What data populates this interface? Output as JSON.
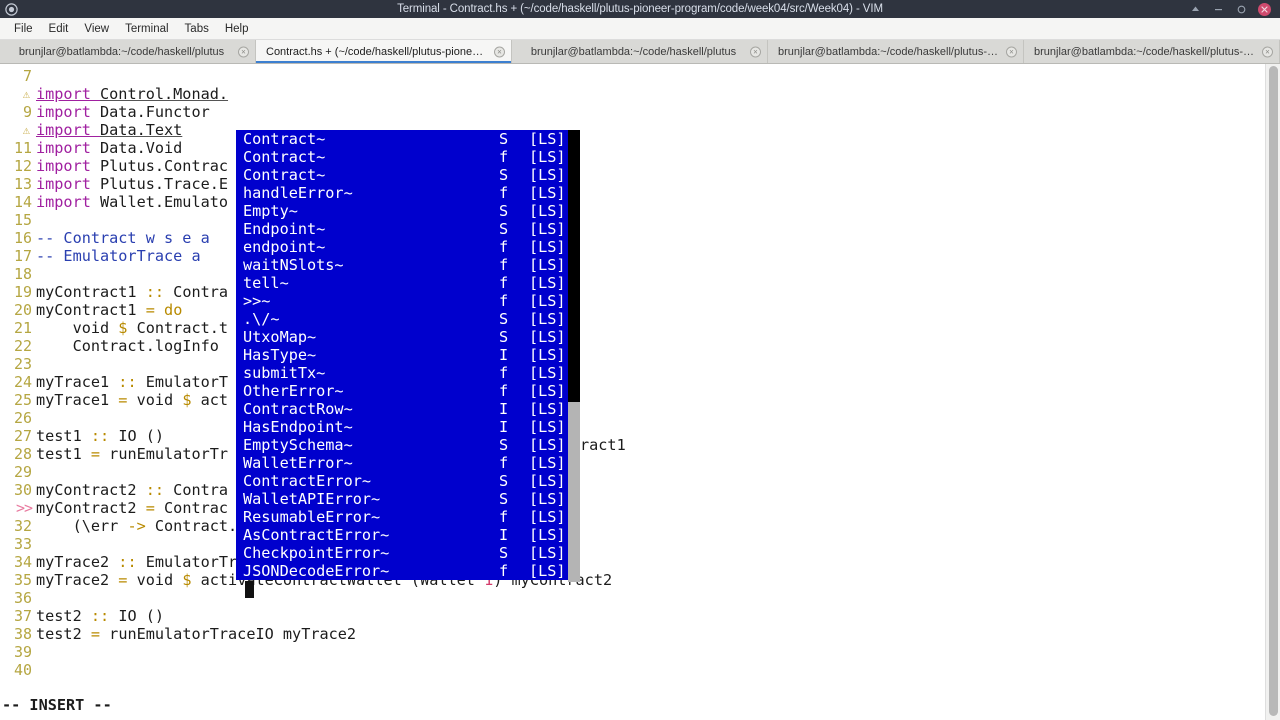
{
  "window": {
    "title": "Terminal - Contract.hs + (~/code/haskell/plutus-pioneer-program/code/week04/src/Week04) - VIM",
    "app_icon": "terminal-icon",
    "controls": [
      {
        "name": "shade-button",
        "glyph": "shade-icon"
      },
      {
        "name": "minimize-button",
        "glyph": "minimize-icon"
      },
      {
        "name": "maximize-button",
        "glyph": "maximize-icon"
      },
      {
        "name": "close-button",
        "glyph": "close-icon"
      }
    ]
  },
  "menubar": {
    "items": [
      {
        "label": "File"
      },
      {
        "label": "Edit"
      },
      {
        "label": "View"
      },
      {
        "label": "Terminal"
      },
      {
        "label": "Tabs"
      },
      {
        "label": "Help"
      }
    ]
  },
  "tabs": [
    {
      "label": "brunjlar@batlambda:~/code/haskell/plutus",
      "active": false,
      "close": "×"
    },
    {
      "label": "Contract.hs + (~/code/haskell/plutus-pioneer-...",
      "active": true,
      "close": "×"
    },
    {
      "label": "brunjlar@batlambda:~/code/haskell/plutus",
      "active": false,
      "close": "×"
    },
    {
      "label": "brunjlar@batlambda:~/code/haskell/plutus-p...",
      "active": false,
      "close": "×"
    },
    {
      "label": "brunjlar@batlambda:~/code/haskell/plutus-h...",
      "active": false,
      "close": "×"
    }
  ],
  "editor": {
    "status_line": "-- INSERT --",
    "lines": [
      {
        "num": "7",
        "gutter_kind": "number",
        "segments": []
      },
      {
        "num": "⚠",
        "gutter_kind": "warn",
        "segments": [
          {
            "t": "import ",
            "c": "kw-u"
          },
          {
            "t": "Control.Monad.",
            "c": "undl"
          }
        ]
      },
      {
        "num": "9",
        "gutter_kind": "number",
        "segments": [
          {
            "t": "import ",
            "c": "kw"
          },
          {
            "t": "Data.Functor",
            "c": "plain"
          }
        ]
      },
      {
        "num": "⚠",
        "gutter_kind": "warn",
        "segments": [
          {
            "t": "import ",
            "c": "kw-u"
          },
          {
            "t": "Data.Text",
            "c": "undl"
          }
        ]
      },
      {
        "num": "11",
        "gutter_kind": "number",
        "segments": [
          {
            "t": "import ",
            "c": "kw"
          },
          {
            "t": "Data.Void",
            "c": "plain"
          }
        ]
      },
      {
        "num": "12",
        "gutter_kind": "number",
        "segments": [
          {
            "t": "import ",
            "c": "kw"
          },
          {
            "t": "Plutus.Contrac",
            "c": "plain"
          }
        ]
      },
      {
        "num": "13",
        "gutter_kind": "number",
        "segments": [
          {
            "t": "import ",
            "c": "kw"
          },
          {
            "t": "Plutus.Trace.E",
            "c": "plain"
          }
        ]
      },
      {
        "num": "14",
        "gutter_kind": "number",
        "segments": [
          {
            "t": "import ",
            "c": "kw"
          },
          {
            "t": "Wallet.Emulato",
            "c": "plain"
          }
        ]
      },
      {
        "num": "15",
        "gutter_kind": "number",
        "segments": []
      },
      {
        "num": "16",
        "gutter_kind": "number",
        "segments": [
          {
            "t": "-- Contract w s e a",
            "c": "cmt"
          }
        ]
      },
      {
        "num": "17",
        "gutter_kind": "number",
        "segments": [
          {
            "t": "-- EmulatorTrace a",
            "c": "cmt"
          }
        ]
      },
      {
        "num": "18",
        "gutter_kind": "number",
        "segments": []
      },
      {
        "num": "19",
        "gutter_kind": "number",
        "segments": [
          {
            "t": "myContract1 ",
            "c": "plain"
          },
          {
            "t": "::",
            "c": "op"
          },
          {
            "t": " Contra",
            "c": "plain"
          }
        ]
      },
      {
        "num": "20",
        "gutter_kind": "number",
        "segments": [
          {
            "t": "myContract1 ",
            "c": "plain"
          },
          {
            "t": "=",
            "c": "op"
          },
          {
            "t": " ",
            "c": "plain"
          },
          {
            "t": "do",
            "c": "op"
          }
        ]
      },
      {
        "num": "21",
        "gutter_kind": "number",
        "segments": [
          {
            "t": "    void ",
            "c": "plain"
          },
          {
            "t": "$",
            "c": "op"
          },
          {
            "t": " Contract.t",
            "c": "plain"
          }
        ]
      },
      {
        "num": "22",
        "gutter_kind": "number",
        "segments": [
          {
            "t": "    Contract.logInfo",
            "c": "plain"
          }
        ]
      },
      {
        "num": "23",
        "gutter_kind": "number",
        "segments": []
      },
      {
        "num": "24",
        "gutter_kind": "number",
        "segments": [
          {
            "t": "myTrace1 ",
            "c": "plain"
          },
          {
            "t": "::",
            "c": "op"
          },
          {
            "t": " EmulatorT",
            "c": "plain"
          }
        ]
      },
      {
        "num": "25",
        "gutter_kind": "number",
        "segments": [
          {
            "t": "myTrace1 ",
            "c": "plain"
          },
          {
            "t": "=",
            "c": "op"
          },
          {
            "t": " void ",
            "c": "plain"
          },
          {
            "t": "$",
            "c": "op"
          },
          {
            "t": " act",
            "c": "plain"
          }
        ]
      },
      {
        "num": "26",
        "gutter_kind": "number",
        "segments": []
      },
      {
        "num": "27",
        "gutter_kind": "number",
        "segments": [
          {
            "t": "test1 ",
            "c": "plain"
          },
          {
            "t": "::",
            "c": "op"
          },
          {
            "t": " IO ()",
            "c": "plain"
          }
        ]
      },
      {
        "num": "28",
        "gutter_kind": "number",
        "segments": [
          {
            "t": "test1 ",
            "c": "plain"
          },
          {
            "t": "=",
            "c": "op"
          },
          {
            "t": " runEmulatorTr",
            "c": "plain"
          }
        ]
      },
      {
        "num": "29",
        "gutter_kind": "number",
        "segments": []
      },
      {
        "num": "30",
        "gutter_kind": "number",
        "segments": [
          {
            "t": "myContract2 ",
            "c": "plain"
          },
          {
            "t": "::",
            "c": "op"
          },
          {
            "t": " Contra",
            "c": "plain"
          }
        ]
      },
      {
        "num": ">>",
        "gutter_kind": "marker",
        "segments": [
          {
            "t": "myContract2 ",
            "c": "plain"
          },
          {
            "t": "=",
            "c": "op"
          },
          {
            "t": " Contrac",
            "c": "plain"
          }
        ]
      },
      {
        "num": "32",
        "gutter_kind": "number",
        "segments": [
          {
            "t": "    (\\err ",
            "c": "plain"
          },
          {
            "t": "->",
            "c": "op"
          },
          {
            "t": " Contract.",
            "c": "plain"
          }
        ]
      },
      {
        "num": "33",
        "gutter_kind": "number",
        "segments": []
      },
      {
        "num": "34",
        "gutter_kind": "number",
        "segments": [
          {
            "t": "myTrace2 ",
            "c": "plain"
          },
          {
            "t": "::",
            "c": "op"
          },
          {
            "t": " EmulatorTrace ()",
            "c": "plain"
          }
        ]
      },
      {
        "num": "35",
        "gutter_kind": "number",
        "segments": [
          {
            "t": "myTrace2 ",
            "c": "plain"
          },
          {
            "t": "=",
            "c": "op"
          },
          {
            "t": " void ",
            "c": "plain"
          },
          {
            "t": "$",
            "c": "op"
          },
          {
            "t": " activateContractWallet (Wallet ",
            "c": "plain"
          },
          {
            "t": "1",
            "c": "num"
          },
          {
            "t": ") myContract2",
            "c": "plain"
          }
        ]
      },
      {
        "num": "36",
        "gutter_kind": "number",
        "segments": []
      },
      {
        "num": "37",
        "gutter_kind": "number",
        "segments": [
          {
            "t": "test2 ",
            "c": "plain"
          },
          {
            "t": "::",
            "c": "op"
          },
          {
            "t": " IO ()",
            "c": "plain"
          }
        ]
      },
      {
        "num": "38",
        "gutter_kind": "number",
        "segments": [
          {
            "t": "test2 ",
            "c": "plain"
          },
          {
            "t": "=",
            "c": "op"
          },
          {
            "t": " runEmulatorTraceIO myTrace2",
            "c": "plain"
          }
        ]
      },
      {
        "num": "39",
        "gutter_kind": "number",
        "segments": []
      },
      {
        "num": "40",
        "gutter_kind": "number",
        "segments": []
      }
    ],
    "overflow_text": {
      "line25_tail": "ract1"
    }
  },
  "autocomplete": {
    "background": "#0000cd",
    "foreground": "#ffffff",
    "entries": [
      {
        "word": "Contract~",
        "kind": "S",
        "menu": "[LS]"
      },
      {
        "word": "Contract~",
        "kind": "f",
        "menu": "[LS]"
      },
      {
        "word": "Contract~",
        "kind": "S",
        "menu": "[LS]"
      },
      {
        "word": "handleError~",
        "kind": "f",
        "menu": "[LS]"
      },
      {
        "word": "Empty~",
        "kind": "S",
        "menu": "[LS]"
      },
      {
        "word": "Endpoint~",
        "kind": "S",
        "menu": "[LS]"
      },
      {
        "word": "endpoint~",
        "kind": "f",
        "menu": "[LS]"
      },
      {
        "word": "waitNSlots~",
        "kind": "f",
        "menu": "[LS]"
      },
      {
        "word": "tell~",
        "kind": "f",
        "menu": "[LS]"
      },
      {
        "word": ">>~",
        "kind": "f",
        "menu": "[LS]"
      },
      {
        "word": ".\\/~",
        "kind": "S",
        "menu": "[LS]"
      },
      {
        "word": "UtxoMap~",
        "kind": "S",
        "menu": "[LS]"
      },
      {
        "word": "HasType~",
        "kind": "I",
        "menu": "[LS]"
      },
      {
        "word": "submitTx~",
        "kind": "f",
        "menu": "[LS]"
      },
      {
        "word": "OtherError~",
        "kind": "f",
        "menu": "[LS]"
      },
      {
        "word": "ContractRow~",
        "kind": "I",
        "menu": "[LS]"
      },
      {
        "word": "HasEndpoint~",
        "kind": "I",
        "menu": "[LS]"
      },
      {
        "word": "EmptySchema~",
        "kind": "S",
        "menu": "[LS]"
      },
      {
        "word": "WalletError~",
        "kind": "f",
        "menu": "[LS]"
      },
      {
        "word": "ContractError~",
        "kind": "S",
        "menu": "[LS]"
      },
      {
        "word": "WalletAPIError~",
        "kind": "S",
        "menu": "[LS]"
      },
      {
        "word": "ResumableError~",
        "kind": "f",
        "menu": "[LS]"
      },
      {
        "word": "AsContractError~",
        "kind": "I",
        "menu": "[LS]"
      },
      {
        "word": "CheckpointError~",
        "kind": "S",
        "menu": "[LS]"
      },
      {
        "word": "JSONDecodeError~",
        "kind": "f",
        "menu": "[LS]"
      }
    ]
  }
}
